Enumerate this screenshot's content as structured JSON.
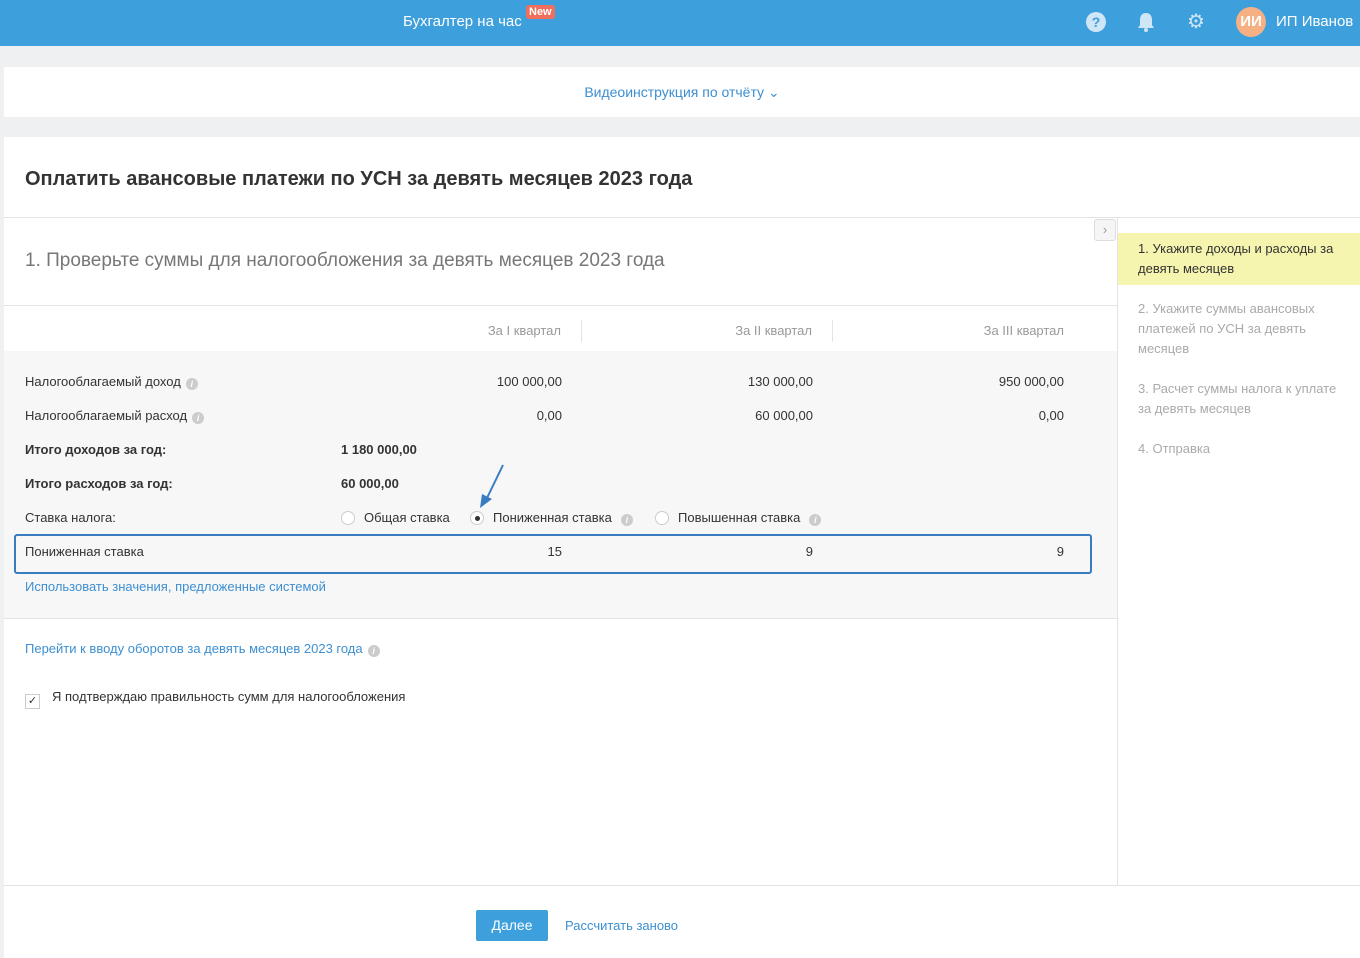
{
  "header": {
    "brand": "Бухгалтер на час",
    "new_badge": "New",
    "avatar_initials": "ИИ",
    "user_name": "ИП Иванов"
  },
  "video": {
    "label": "Видеоинструкция по отчёту"
  },
  "page": {
    "title": "Оплатить авансовые платежи по УСН за девять месяцев 2023 года",
    "section_title": "1. Проверьте суммы для налогообложения за девять месяцев 2023 года"
  },
  "table": {
    "columns": [
      "За I квартал",
      "За II квартал",
      "За III квартал"
    ],
    "income": {
      "label": "Налогооблагаемый доход",
      "values": [
        "100 000,00",
        "130 000,00",
        "950 000,00"
      ]
    },
    "expense": {
      "label": "Налогооблагаемый расход",
      "values": [
        "0,00",
        "60 000,00",
        "0,00"
      ]
    },
    "total_income": {
      "label": "Итого доходов за год:",
      "value": "1 180 000,00"
    },
    "total_expense": {
      "label": "Итого расходов за год:",
      "value": "60 000,00"
    },
    "rate": {
      "label": "Ставка налога:",
      "options": [
        "Общая ставка",
        "Пониженная ставка",
        "Повышенная ставка"
      ],
      "selected": "Пониженная ставка"
    },
    "reduced": {
      "label": "Пониженная ставка",
      "values": [
        "15",
        "9",
        "9"
      ]
    },
    "use_system_link": "Использовать значения, предложенные системой"
  },
  "turnover_link": "Перейти к вводу оборотов за девять месяцев 2023 года",
  "confirm": {
    "label": "Я подтверждаю правильность сумм для налогообложения",
    "checked": true
  },
  "steps": [
    "1.  Укажите доходы и расходы за девять месяцев",
    "2.  Укажите суммы авансовых платежей по УСН за девять месяцев",
    "3.  Расчет суммы налога к уплате за девять месяцев",
    "4.  Отправка"
  ],
  "footer": {
    "next": "Далее",
    "recalc": "Рассчитать заново"
  },
  "colors": {
    "brand": "#3d9fdc",
    "badge": "#f06e5c",
    "active_step": "#f5f5b0",
    "highlight_border": "#3a7cc1"
  }
}
